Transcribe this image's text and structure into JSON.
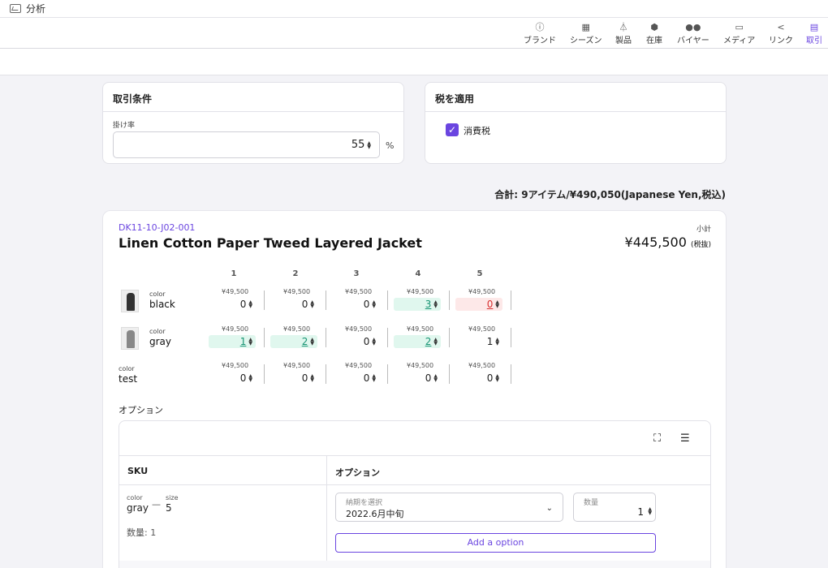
{
  "topbar": {
    "title": "分析"
  },
  "nav": {
    "items": [
      "ブランド",
      "シーズン",
      "製品",
      "在庫",
      "バイヤー",
      "メディア",
      "リンク",
      "取引"
    ]
  },
  "terms": {
    "title": "取引条件",
    "rate_label": "掛け率",
    "rate_value": "55",
    "unit": "%"
  },
  "tax": {
    "title": "税を適用",
    "checkbox_label": "消費税"
  },
  "total": "合計:  9アイテム/¥490,050(Japanese Yen,税込)",
  "product": {
    "code": "DK11-10-J02-001",
    "name": "Linen Cotton Paper Tweed Layered Jacket",
    "subtotal_label": "小計",
    "subtotal_value": "¥445,500",
    "subtotal_note": "(税抜)",
    "sizes": [
      "1",
      "2",
      "3",
      "4",
      "5"
    ],
    "color_label": "color",
    "rows": [
      {
        "color": "black",
        "thumb": true,
        "prices": [
          "¥49,500",
          "¥49,500",
          "¥49,500",
          "¥49,500",
          "¥49,500"
        ],
        "qty": [
          "0",
          "0",
          "0",
          "3",
          "0"
        ]
      },
      {
        "color": "gray",
        "thumb": true,
        "prices": [
          "¥49,500",
          "¥49,500",
          "¥49,500",
          "¥49,500",
          "¥49,500"
        ],
        "qty": [
          "1",
          "2",
          "0",
          "2",
          "1"
        ]
      },
      {
        "color": "test",
        "thumb": false,
        "prices": [
          "¥49,500",
          "¥49,500",
          "¥49,500",
          "¥49,500",
          "¥49,500"
        ],
        "qty": [
          "0",
          "0",
          "0",
          "0",
          "0"
        ]
      }
    ]
  },
  "options": {
    "title": "オプション",
    "col_sku": "SKU",
    "col_option": "オプション",
    "sku_color_label": "color",
    "sku_color": "gray",
    "sku_size_label": "size",
    "sku_size": "5",
    "sku_qty": "数量: 1",
    "date_label": "納期を選択",
    "date_value": "2022.6月中旬",
    "qty_label": "数量",
    "qty_value": "1",
    "add_label": "Add a option"
  },
  "colors": {
    "accent": "#6a45e0",
    "highlight_green": "#e0f7ee",
    "highlight_red": "#fde8e8"
  }
}
